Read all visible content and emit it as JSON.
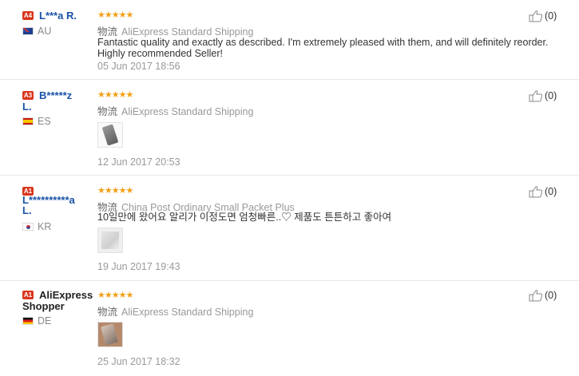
{
  "reviews": [
    {
      "level": "A4",
      "user": "L***a R.",
      "user_tail": "",
      "country": "AU",
      "flag": "australia-flag",
      "rating": 5,
      "shipping_prefix": "物流",
      "shipping": "AliExpress Standard Shipping",
      "text": "Fantastic quality and exactly as described. I'm extremely pleased with them, and will definitely reorder. Highly recommended Seller!",
      "photo": null,
      "date": "05 Jun 2017 18:56",
      "helpful": "(0)"
    },
    {
      "level": "A3",
      "user": "B*****z",
      "user_tail": "L.",
      "country": "ES",
      "flag": "spain-flag",
      "rating": 5,
      "shipping_prefix": "物流",
      "shipping": "AliExpress Standard Shipping",
      "text": "",
      "photo": "phone-case-photo",
      "date": "12 Jun 2017 20:53",
      "helpful": "(0)"
    },
    {
      "level": "A1",
      "user": "L**********a",
      "user_tail": "L.",
      "country": "KR",
      "flag": "south-korea-flag",
      "rating": 5,
      "shipping_prefix": "物流",
      "shipping": "China Post Ordinary Small Packet Plus",
      "text": "10일만에 왔어요 알리가 이정도면 엄청빠른..♡ 제품도 튼튼하고 좋아여",
      "photo": "package-photo",
      "date": "19 Jun 2017 19:43",
      "helpful": "(0)"
    },
    {
      "level": "A1",
      "user": "AliExpress",
      "user_tail": "Shopper",
      "country": "DE",
      "flag": "germany-flag",
      "rating": 5,
      "shipping_prefix": "物流",
      "shipping": "AliExpress Standard Shipping",
      "text": "",
      "photo": "product-photo",
      "date": "25 Jun 2017 18:32",
      "helpful": "(0)"
    }
  ],
  "colors": {
    "badge": "#d9361d",
    "username": "#1a53a8",
    "stars": "#f2a016",
    "muted": "#999999"
  }
}
